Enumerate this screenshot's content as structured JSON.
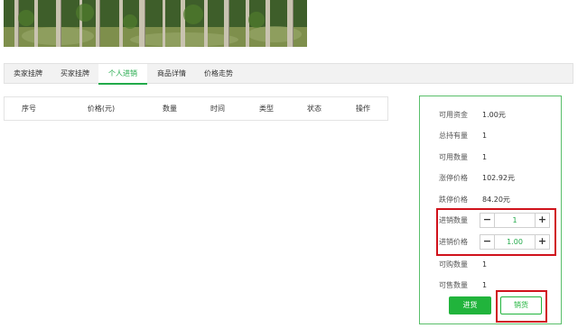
{
  "tabs": [
    {
      "label": "卖家挂牌",
      "active": false
    },
    {
      "label": "买家挂牌",
      "active": false
    },
    {
      "label": "个人进销",
      "active": true
    },
    {
      "label": "商品详情",
      "active": false
    },
    {
      "label": "价格走势",
      "active": false
    }
  ],
  "table": {
    "headers": [
      "序号",
      "价格(元)",
      "数量",
      "时间",
      "类型",
      "状态",
      "操作"
    ]
  },
  "panel": {
    "available_funds_label": "可用资金",
    "available_funds_value": "1.00元",
    "total_holdings_label": "总持有量",
    "total_holdings_value": "1",
    "available_qty_label": "可用数量",
    "available_qty_value": "1",
    "limit_up_label": "涨停价格",
    "limit_up_value": "102.92元",
    "limit_down_label": "跌停价格",
    "limit_down_value": "84.20元",
    "trade_qty_label": "进销数量",
    "trade_qty_value": "1",
    "trade_price_label": "进销价格",
    "trade_price_value": "1.00",
    "buyable_qty_label": "可购数量",
    "buyable_qty_value": "1",
    "sellable_qty_label": "可售数量",
    "sellable_qty_value": "1",
    "buy_button": "进货",
    "sell_button": "销货"
  },
  "controls": {
    "minus": "−",
    "plus": "+"
  },
  "colors": {
    "accent": "#22aa4a",
    "highlight_box": "#d0121b"
  }
}
